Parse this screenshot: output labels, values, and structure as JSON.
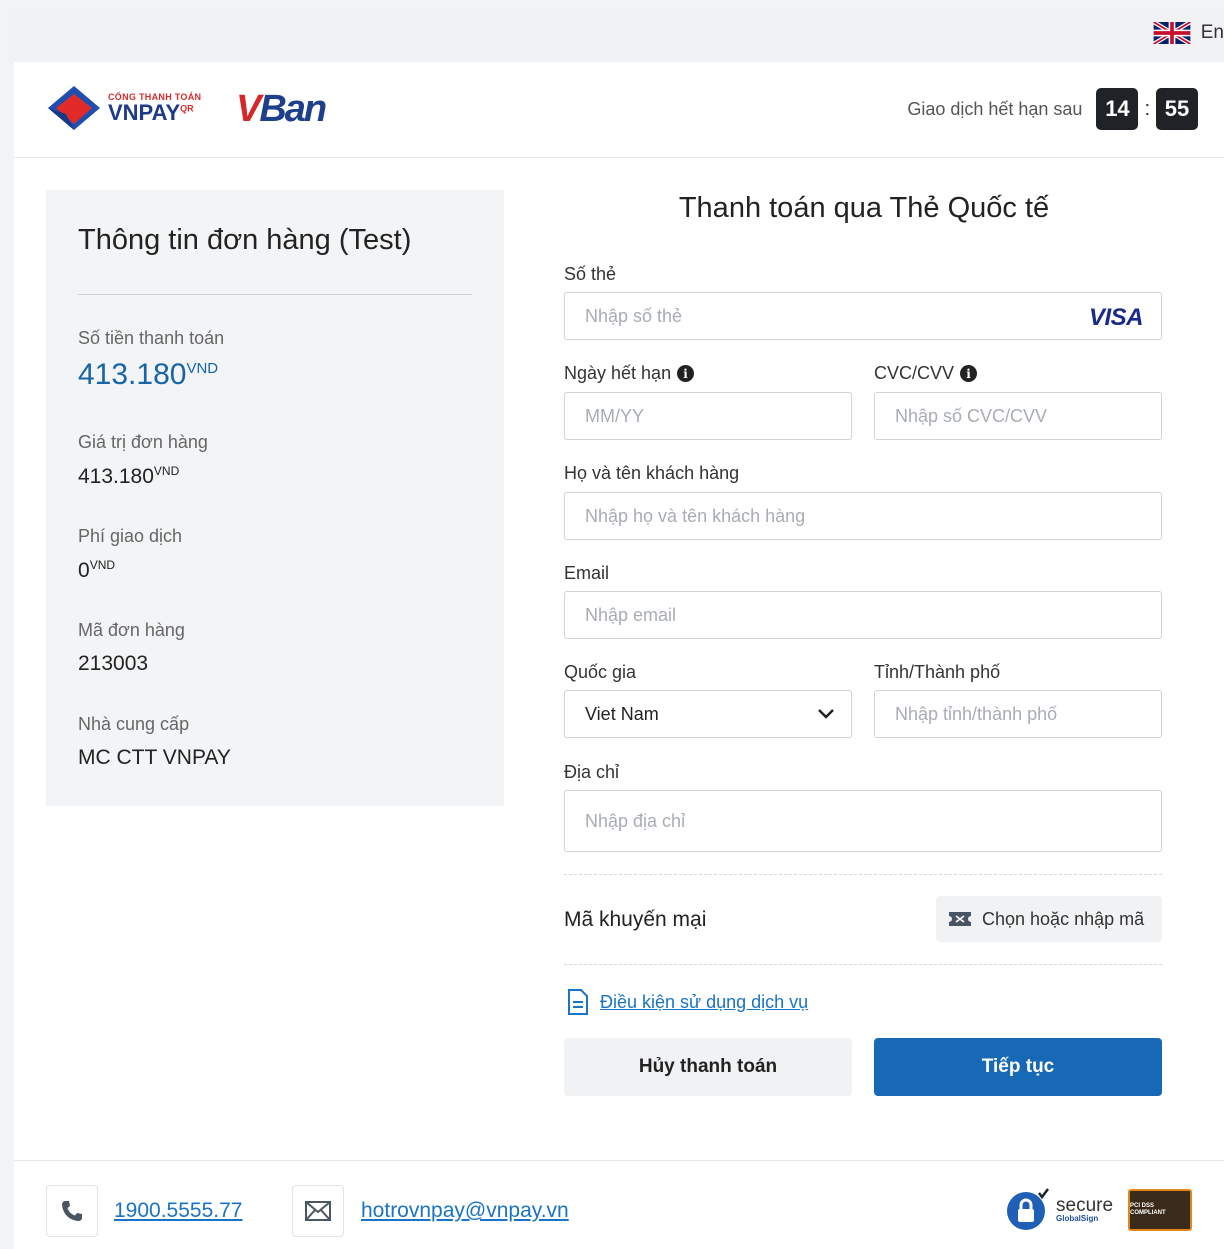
{
  "topbar": {
    "language": "En"
  },
  "header": {
    "logo_vnpay_small": "CỔNG THANH TOÁN",
    "logo_vnpay_big": "VNPAY",
    "logo_vnpay_qr": "QR",
    "logo_vban": "Ban",
    "timer_label": "Giao dịch hết hạn sau",
    "timer_minutes": "14",
    "timer_separator": ":",
    "timer_seconds": "55"
  },
  "order": {
    "title": "Thông tin đơn hàng (Test)",
    "amount_label": "Số tiền thanh toán",
    "amount_value": "413.180",
    "amount_currency": "VND",
    "order_value_label": "Giá trị đơn hàng",
    "order_value": "413.180",
    "order_value_currency": "VND",
    "fee_label": "Phí giao dịch",
    "fee_value": "0",
    "fee_currency": "VND",
    "order_id_label": "Mã đơn hàng",
    "order_id": "213003",
    "provider_label": "Nhà cung cấp",
    "provider": "MC CTT VNPAY"
  },
  "form": {
    "title": "Thanh toán qua Thẻ Quốc tế",
    "card_number_label": "Số thẻ",
    "card_number_placeholder": "Nhập số thẻ",
    "card_brand": "VISA",
    "expiry_label": "Ngày hết hạn",
    "expiry_placeholder": "MM/YY",
    "cvc_label": "CVC/CVV",
    "cvc_placeholder": "Nhập số CVC/CVV",
    "name_label": "Họ và tên khách hàng",
    "name_placeholder": "Nhập họ và tên khách hàng",
    "email_label": "Email",
    "email_placeholder": "Nhập email",
    "country_label": "Quốc gia",
    "country_value": "Viet Nam",
    "city_label": "Tỉnh/Thành phố",
    "city_placeholder": "Nhập tỉnh/thành phố",
    "address_label": "Địa chỉ",
    "address_placeholder": "Nhập địa chỉ",
    "promo_label": "Mã khuyến mại",
    "promo_button": "Chọn hoặc nhập mã",
    "terms_link": "Điều kiện sử dụng dịch vụ",
    "cancel_button": "Hủy thanh toán",
    "continue_button": "Tiếp tục"
  },
  "footer": {
    "phone": "1900.5555.77",
    "email": "hotrovnpay@vnpay.vn",
    "secure_text": "secure",
    "secure_sub": "GlobalSign",
    "pci_text": "PCI DSS COMPLIANT"
  },
  "colors": {
    "primary": "#1769b5",
    "amount": "#1565a8",
    "link": "#1a73c4",
    "timer_bg": "#1f2328"
  },
  "icons": [
    "uk-flag-icon",
    "info-icon",
    "chevron-down-icon",
    "ticket-icon",
    "document-icon",
    "phone-icon",
    "mail-icon",
    "lock-icon"
  ]
}
